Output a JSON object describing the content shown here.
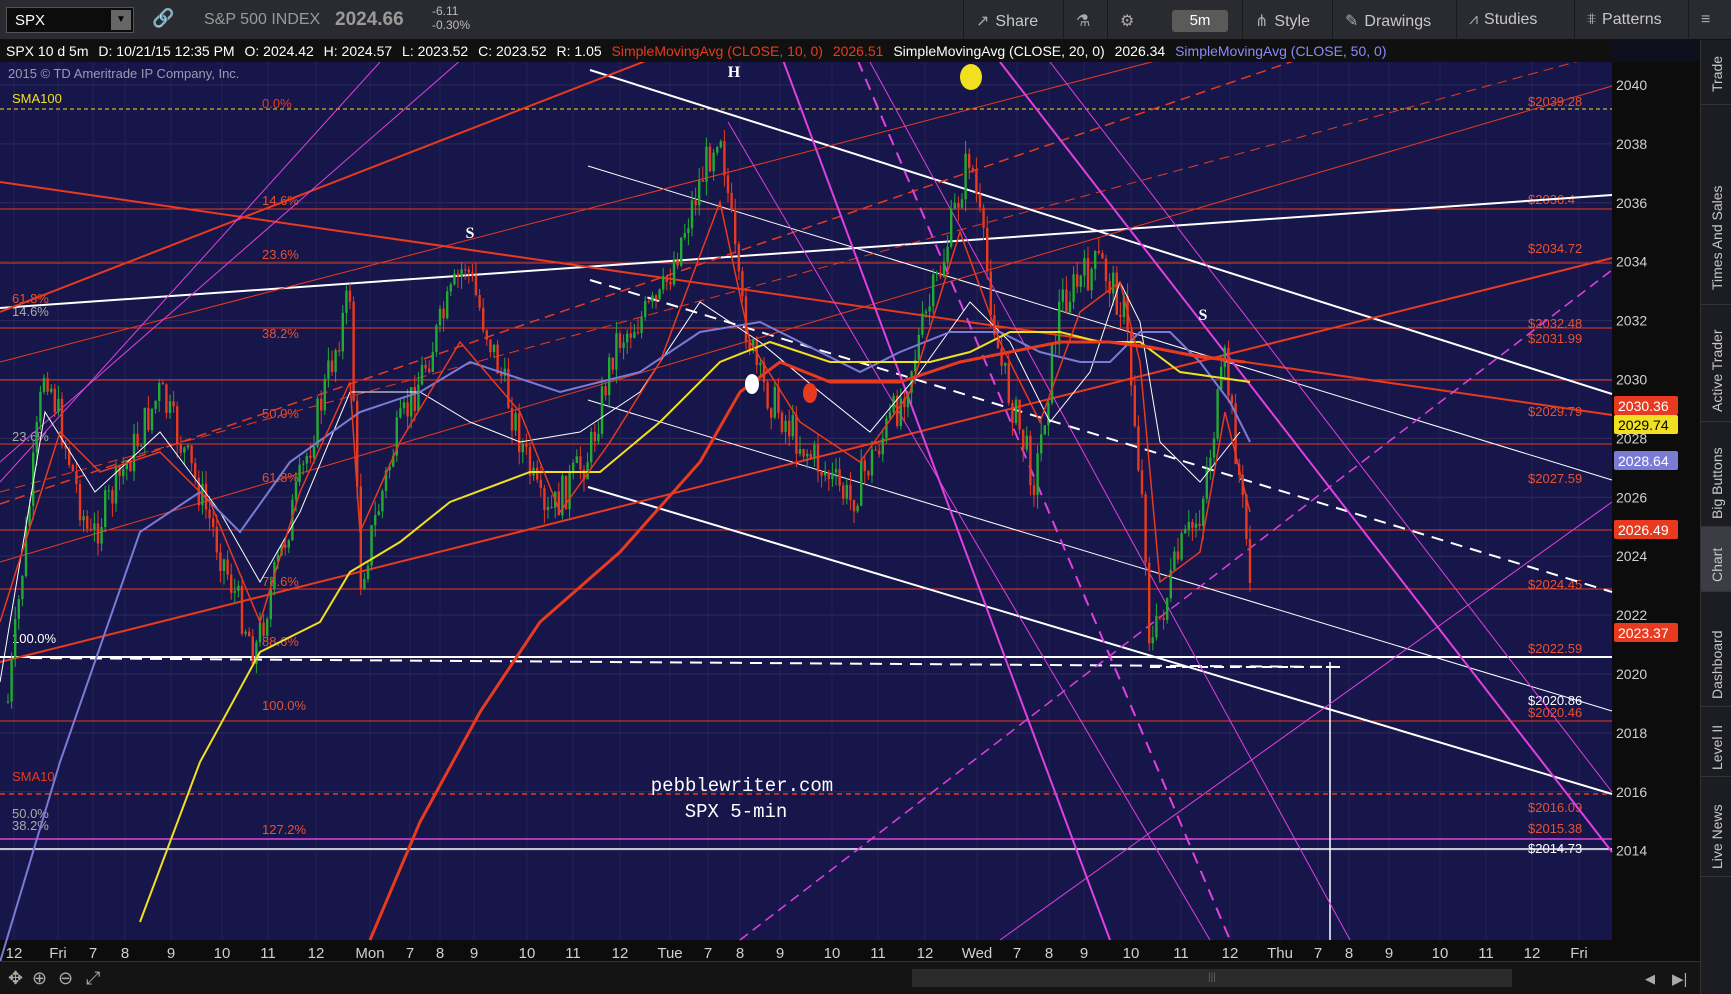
{
  "toolbar": {
    "symbol": "SPX",
    "instrument_name": "S&P 500 INDEX",
    "last_price": "2024.66",
    "net_change": "-6.11",
    "pct_change": "-0.30%",
    "share_label": "Share",
    "interval_label": "5m",
    "style_label": "Style",
    "drawings_label": "Drawings",
    "studies_label": "Studies",
    "patterns_label": "Patterns"
  },
  "infobar": {
    "descriptor": "SPX 10 d 5m",
    "date": "D: 10/21/15 12:35 PM",
    "open": "O: 2024.42",
    "high": "H: 2024.57",
    "low": "L: 2023.52",
    "close": "C: 2023.52",
    "range": "R: 1.05",
    "sma10_label": "SimpleMovingAvg (CLOSE, 10, 0)",
    "sma10_value": "2026.51",
    "sma20_label": "SimpleMovingAvg (CLOSE, 20, 0)",
    "sma20_value": "2026.34",
    "sma50_label": "SimpleMovingAvg (CLOSE, 50, 0)"
  },
  "chart": {
    "copyright": "2015 © TD Ameritrade IP Company, Inc.",
    "watermark_line1": "pebblewriter.com",
    "watermark_line2": "SPX 5-min",
    "pattern_labels": [
      "H",
      "S",
      "S"
    ],
    "price_axis": [
      "2040",
      "2038",
      "2036",
      "2034",
      "2032",
      "2030",
      "2028",
      "2026",
      "2024",
      "2022",
      "2020",
      "2018",
      "2016",
      "2014"
    ],
    "time_axis": [
      "12",
      "Fri",
      "7",
      "8",
      "9",
      "10",
      "11",
      "12",
      "Mon",
      "7",
      "8",
      "9",
      "10",
      "11",
      "12",
      "Tue",
      "7",
      "8",
      "9",
      "10",
      "11",
      "12",
      "Wed",
      "7",
      "8",
      "9",
      "10",
      "11",
      "12",
      "Thu",
      "7",
      "8",
      "9",
      "10",
      "11",
      "12",
      "Fri"
    ],
    "axis_badges": [
      {
        "text": "2030.36",
        "color": "#e83a1f"
      },
      {
        "text": "2029.74",
        "color": "#f0e020"
      },
      {
        "text": "2028.64",
        "color": "#7b7bd6"
      },
      {
        "text": "2026.49",
        "color": "#e83a1f"
      },
      {
        "text": "2023.37",
        "color": "#e83a1f"
      }
    ],
    "fib_left_labels": [
      "0.0%",
      "14.6%",
      "23.6%",
      "38.2%",
      "50.0%",
      "61.8%",
      "78.6%",
      "88.6%",
      "100.0%",
      "127.2%"
    ],
    "fib_right_labels": [
      "$2039.28",
      "$2036.4",
      "$2034.72",
      "$2032.48",
      "$2031.99",
      "$2029.79",
      "$2027.59",
      "$2024.45",
      "$2022.59",
      "$2020.86",
      "$2020.46",
      "$2016.09",
      "$2015.38",
      "$2014.73"
    ],
    "left_edge_labels": [
      "SMA100",
      "61.8%",
      "14.6%",
      "23.6%",
      "100.0%",
      "SMA10",
      "50.0%",
      "38.2%"
    ]
  },
  "sidebar": [
    "Trade",
    "Times And Sales",
    "Active Trader",
    "Big Buttons",
    "Chart",
    "Dashboard",
    "Level II",
    "Live News"
  ],
  "colors": {
    "chart_bg": "#17164a",
    "up_candle": "#22aa33",
    "down_candle": "#e83a1f",
    "sma10": "#e83a1f",
    "sma20": "#f0e020",
    "sma50": "#7b7bd6",
    "magenta": "#e040e0"
  }
}
